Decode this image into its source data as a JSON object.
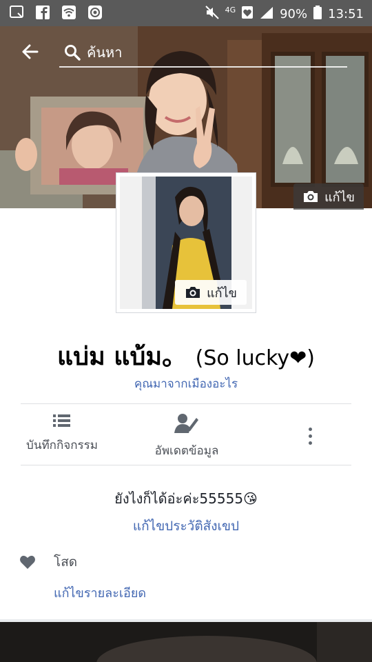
{
  "status_bar": {
    "left_icons": [
      "screenshot-icon",
      "facebook-icon",
      "wifi-icon",
      "record-icon"
    ],
    "signal_type": "4G",
    "battery": "90%",
    "time": "13:51"
  },
  "header": {
    "back_icon": "arrow-left-icon",
    "search_placeholder": "ค้นหา"
  },
  "cover": {
    "edit_label": "แก้ไข"
  },
  "profile_picture": {
    "edit_label": "แก้ไข"
  },
  "profile": {
    "name": "แบ่ม แบ้ม。",
    "name_suffix": "(So lucky❤)",
    "hometown_prompt": "คุณมาจากเมืองอะไร"
  },
  "actions": [
    {
      "label": "บันทึกกิจกรรม",
      "icon": "list-icon"
    },
    {
      "label": "อัพเดตข้อมูล",
      "icon": "edit-profile-icon"
    }
  ],
  "more_icon": "more-vertical-icon",
  "bio": {
    "text": "ยังไงก็ได้อ่ะค่ะ55555😘",
    "edit_label": "แก้ไขประวัติสังเขป"
  },
  "relationship": {
    "icon": "heart-icon",
    "status": "โสด",
    "edit_details_label": "แก้ไขรายละเอียด"
  },
  "colors": {
    "link": "#4267b2",
    "status_bar": "#5a5a5a",
    "icon_gray": "#606770"
  }
}
